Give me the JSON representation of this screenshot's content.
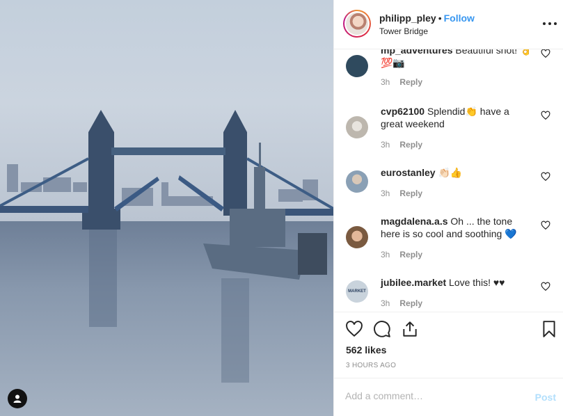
{
  "post": {
    "username": "philipp_pley",
    "separator": "•",
    "follow_label": "Follow",
    "location": "Tower Bridge"
  },
  "comments": [
    {
      "user": "mp_adventures",
      "text": "Beautiful shot! 👌💯📷",
      "time": "3h",
      "reply_label": "Reply",
      "avatar_color": "#2f4a5e"
    },
    {
      "user": "cvp62100",
      "text": "Splendid👏 have a great weekend",
      "time": "3h",
      "reply_label": "Reply",
      "avatar_color": "#cfcac2"
    },
    {
      "user": "eurostanley",
      "text": "👏🏻👍",
      "time": "3h",
      "reply_label": "Reply",
      "avatar_color": "#8aa0b5"
    },
    {
      "user": "magdalena.a.s",
      "text": "Oh ... the tone here is so cool and soothing 💙",
      "time": "3h",
      "reply_label": "Reply",
      "avatar_color": "#b58060"
    },
    {
      "user": "jubilee.market",
      "text": "Love this! ♥♥",
      "time": "3h",
      "reply_label": "Reply",
      "avatar_color": "#c9d3dc",
      "avatar_text": "MARKET"
    }
  ],
  "actions": {
    "likes": "562 likes",
    "time_ago": "3 HOURS AGO"
  },
  "add_comment": {
    "placeholder": "Add a comment…",
    "post_label": "Post"
  },
  "colors": {
    "link_blue": "#3897f0",
    "post_disabled": "#b2dffc",
    "meta_gray": "#8e8e8e",
    "border": "#efefef"
  },
  "icons": [
    "more-options-icon",
    "heart-icon",
    "comment-icon",
    "share-icon",
    "bookmark-icon",
    "user-tag-icon"
  ]
}
